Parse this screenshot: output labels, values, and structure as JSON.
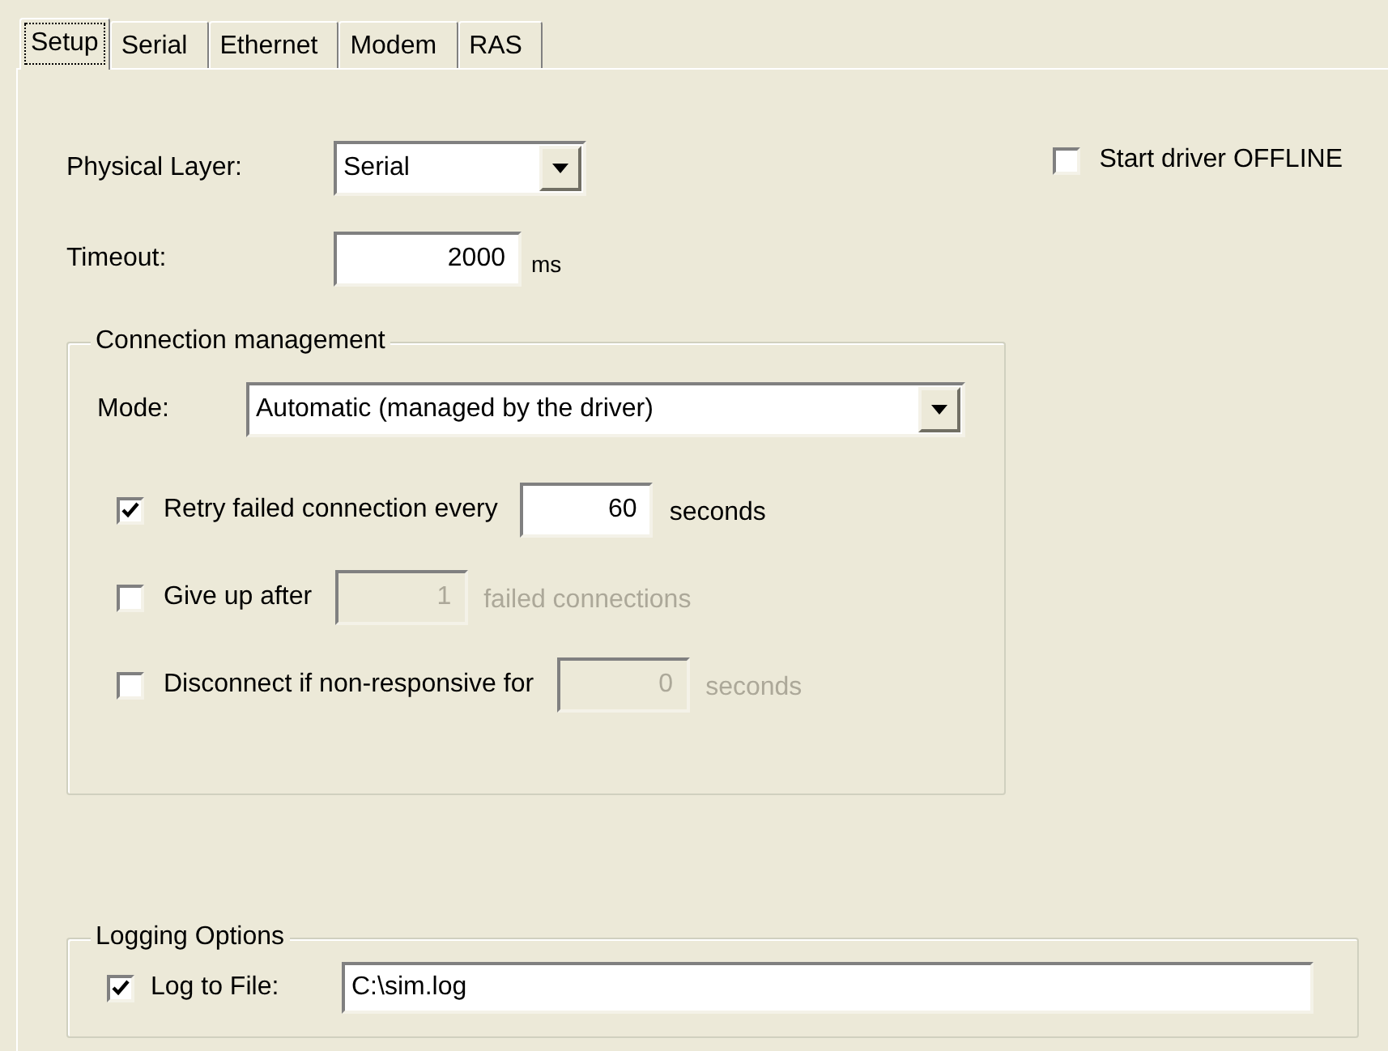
{
  "tabs": [
    {
      "label": "Setup",
      "selected": true
    },
    {
      "label": "Serial",
      "selected": false
    },
    {
      "label": "Ethernet",
      "selected": false
    },
    {
      "label": "Modem",
      "selected": false
    },
    {
      "label": "RAS",
      "selected": false
    }
  ],
  "physical_layer": {
    "label": "Physical Layer:",
    "value": "Serial"
  },
  "start_offline": {
    "label": "Start driver OFFLINE",
    "checked": false
  },
  "timeout": {
    "label": "Timeout:",
    "value": "2000",
    "unit": "ms"
  },
  "connection_management": {
    "title": "Connection management",
    "mode": {
      "label": "Mode:",
      "value": "Automatic (managed by the driver)"
    },
    "options": [
      {
        "label": "Retry failed connection every",
        "checked": true,
        "value": "60",
        "unit": "seconds",
        "disabled": false
      },
      {
        "label": "Give up after",
        "checked": false,
        "value": "1",
        "unit": "failed connections",
        "disabled": true
      },
      {
        "label": "Disconnect if non-responsive for",
        "checked": false,
        "value": "0",
        "unit": "seconds",
        "disabled": true
      }
    ]
  },
  "logging_options": {
    "title": "Logging Options",
    "log_to_file": {
      "label": "Log to File:",
      "checked": true,
      "value": "C:\\sim.log"
    }
  }
}
